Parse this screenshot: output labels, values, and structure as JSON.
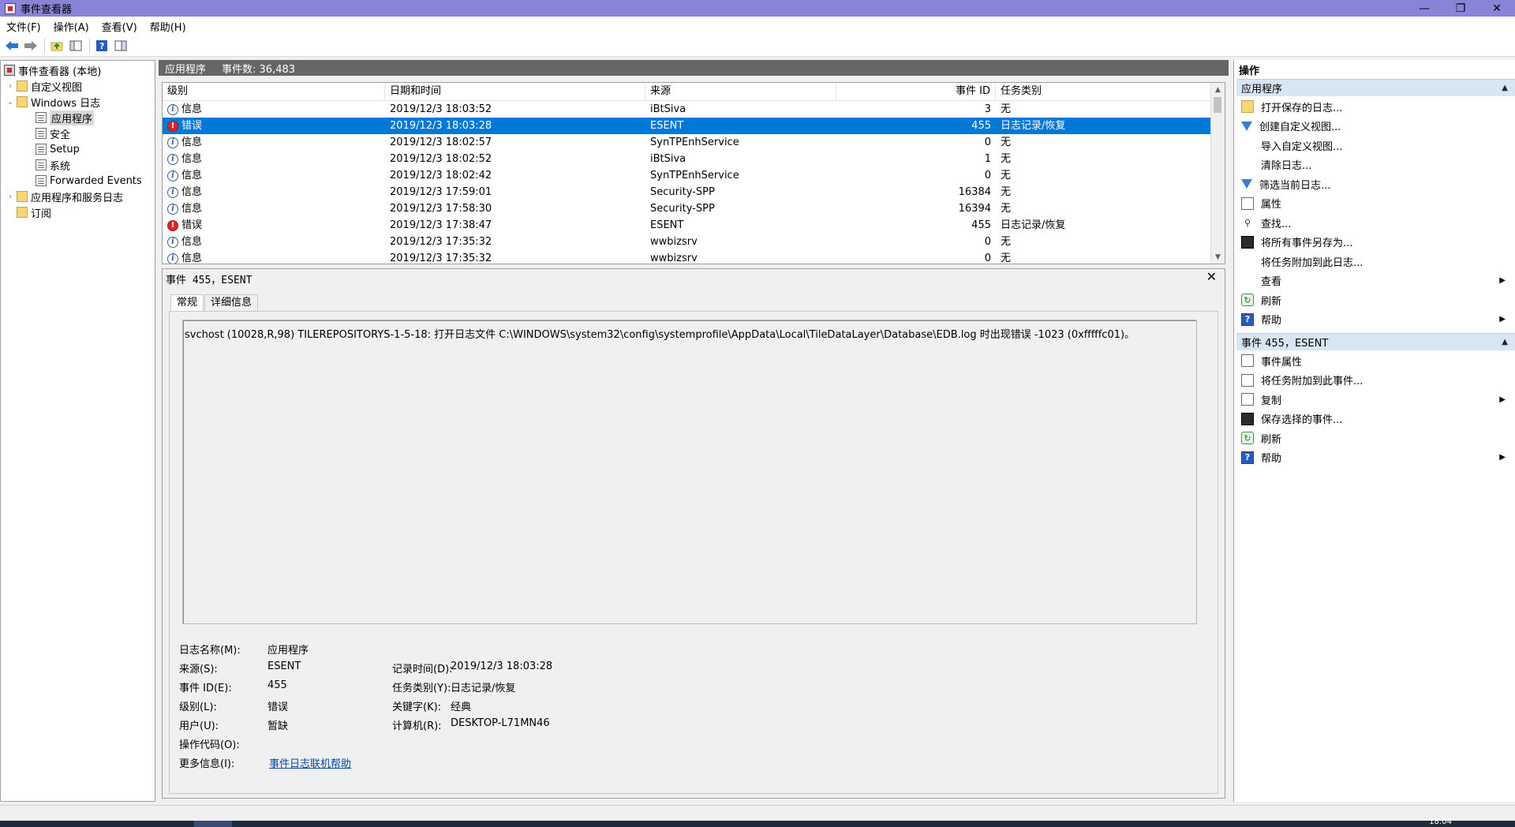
{
  "window": {
    "title": "事件查看器",
    "min": "—",
    "max": "❐",
    "close": "✕"
  },
  "menu": [
    "文件(F)",
    "操作(A)",
    "查看(V)",
    "帮助(H)"
  ],
  "toolbar": {
    "icons": [
      "back-icon",
      "forward-icon",
      "up-folder-icon",
      "show-hide-tree-icon",
      "help-icon",
      "action-pane-icon"
    ]
  },
  "tree": {
    "root": "事件查看器 (本地)",
    "custom_views": "自定义视图",
    "windows_logs": "Windows 日志",
    "logs": [
      "应用程序",
      "安全",
      "Setup",
      "系统",
      "Forwarded Events"
    ],
    "app_service_logs": "应用程序和服务日志",
    "subscriptions": "订阅"
  },
  "center": {
    "log_name": "应用程序",
    "count_label": "事件数: 36,483",
    "columns": [
      "级别",
      "日期和时间",
      "来源",
      "事件 ID",
      "任务类别"
    ],
    "events": [
      {
        "level": "信息",
        "type": "info",
        "datetime": "2019/12/3 18:03:52",
        "source": "iBtSiva",
        "event_id": "3",
        "category": "无"
      },
      {
        "level": "错误",
        "type": "error",
        "datetime": "2019/12/3 18:03:28",
        "source": "ESENT",
        "event_id": "455",
        "category": "日志记录/恢复",
        "selected": true
      },
      {
        "level": "信息",
        "type": "info",
        "datetime": "2019/12/3 18:02:57",
        "source": "SynTPEnhService",
        "event_id": "0",
        "category": "无"
      },
      {
        "level": "信息",
        "type": "info",
        "datetime": "2019/12/3 18:02:52",
        "source": "iBtSiva",
        "event_id": "1",
        "category": "无"
      },
      {
        "level": "信息",
        "type": "info",
        "datetime": "2019/12/3 18:02:42",
        "source": "SynTPEnhService",
        "event_id": "0",
        "category": "无"
      },
      {
        "level": "信息",
        "type": "info",
        "datetime": "2019/12/3 17:59:01",
        "source": "Security-SPP",
        "event_id": "16384",
        "category": "无"
      },
      {
        "level": "信息",
        "type": "info",
        "datetime": "2019/12/3 17:58:30",
        "source": "Security-SPP",
        "event_id": "16394",
        "category": "无"
      },
      {
        "level": "错误",
        "type": "error",
        "datetime": "2019/12/3 17:38:47",
        "source": "ESENT",
        "event_id": "455",
        "category": "日志记录/恢复"
      },
      {
        "level": "信息",
        "type": "info",
        "datetime": "2019/12/3 17:35:32",
        "source": "wwbizsrv",
        "event_id": "0",
        "category": "无"
      },
      {
        "level": "信息",
        "type": "info",
        "datetime": "2019/12/3 17:35:32",
        "source": "wwbizsrv",
        "event_id": "0",
        "category": "无"
      }
    ]
  },
  "detail": {
    "title": "事件 455，ESENT",
    "tabs": [
      "常规",
      "详细信息"
    ],
    "message": "svchost (10028,R,98) TILEREPOSITORYS-1-5-18: 打开日志文件 C:\\WINDOWS\\system32\\config\\systemprofile\\AppData\\Local\\TileDataLayer\\Database\\EDB.log 时出现错误 -1023 (0xfffffc01)。",
    "labels": {
      "log_name": "日志名称(M):",
      "source": "来源(S):",
      "event_id": "事件 ID(E):",
      "level": "级别(L):",
      "user": "用户(U):",
      "opcode": "操作代码(O):",
      "more_info": "更多信息(I):",
      "logged": "记录时间(D):",
      "task_category": "任务类别(Y):",
      "keywords": "关键字(K):",
      "computer": "计算机(R):"
    },
    "values": {
      "log_name": "应用程序",
      "source": "ESENT",
      "event_id": "455",
      "level": "错误",
      "user": "暂缺",
      "opcode": "",
      "more_info": "事件日志联机帮助",
      "logged": "2019/12/3 18:03:28",
      "task_category": "日志记录/恢复",
      "keywords": "经典",
      "computer": "DESKTOP-L71MN46"
    }
  },
  "actions": {
    "title": "操作",
    "section1": "应用程序",
    "items1": [
      {
        "label": "打开保存的日志...",
        "icon": "open-folder-icon"
      },
      {
        "label": "创建自定义视图...",
        "icon": "filter-icon"
      },
      {
        "label": "导入自定义视图...",
        "icon": ""
      },
      {
        "label": "清除日志...",
        "icon": ""
      },
      {
        "label": "筛选当前日志...",
        "icon": "filter-icon"
      },
      {
        "label": "属性",
        "icon": "properties-icon"
      },
      {
        "label": "查找...",
        "icon": "find-icon"
      },
      {
        "label": "将所有事件另存为...",
        "icon": "save-icon"
      },
      {
        "label": "将任务附加到此日志...",
        "icon": ""
      },
      {
        "label": "查看",
        "icon": "",
        "submenu": true
      },
      {
        "label": "刷新",
        "icon": "refresh-icon"
      },
      {
        "label": "帮助",
        "icon": "help-icon",
        "submenu": true
      }
    ],
    "section2": "事件 455，ESENT",
    "items2": [
      {
        "label": "事件属性",
        "icon": "properties-icon"
      },
      {
        "label": "将任务附加到此事件...",
        "icon": "task-icon"
      },
      {
        "label": "复制",
        "icon": "copy-icon",
        "submenu": true
      },
      {
        "label": "保存选择的事件...",
        "icon": "save-icon"
      },
      {
        "label": "刷新",
        "icon": "refresh-icon"
      },
      {
        "label": "帮助",
        "icon": "help-icon",
        "submenu": true
      }
    ]
  },
  "taskbar": {
    "clock": "18:04"
  }
}
